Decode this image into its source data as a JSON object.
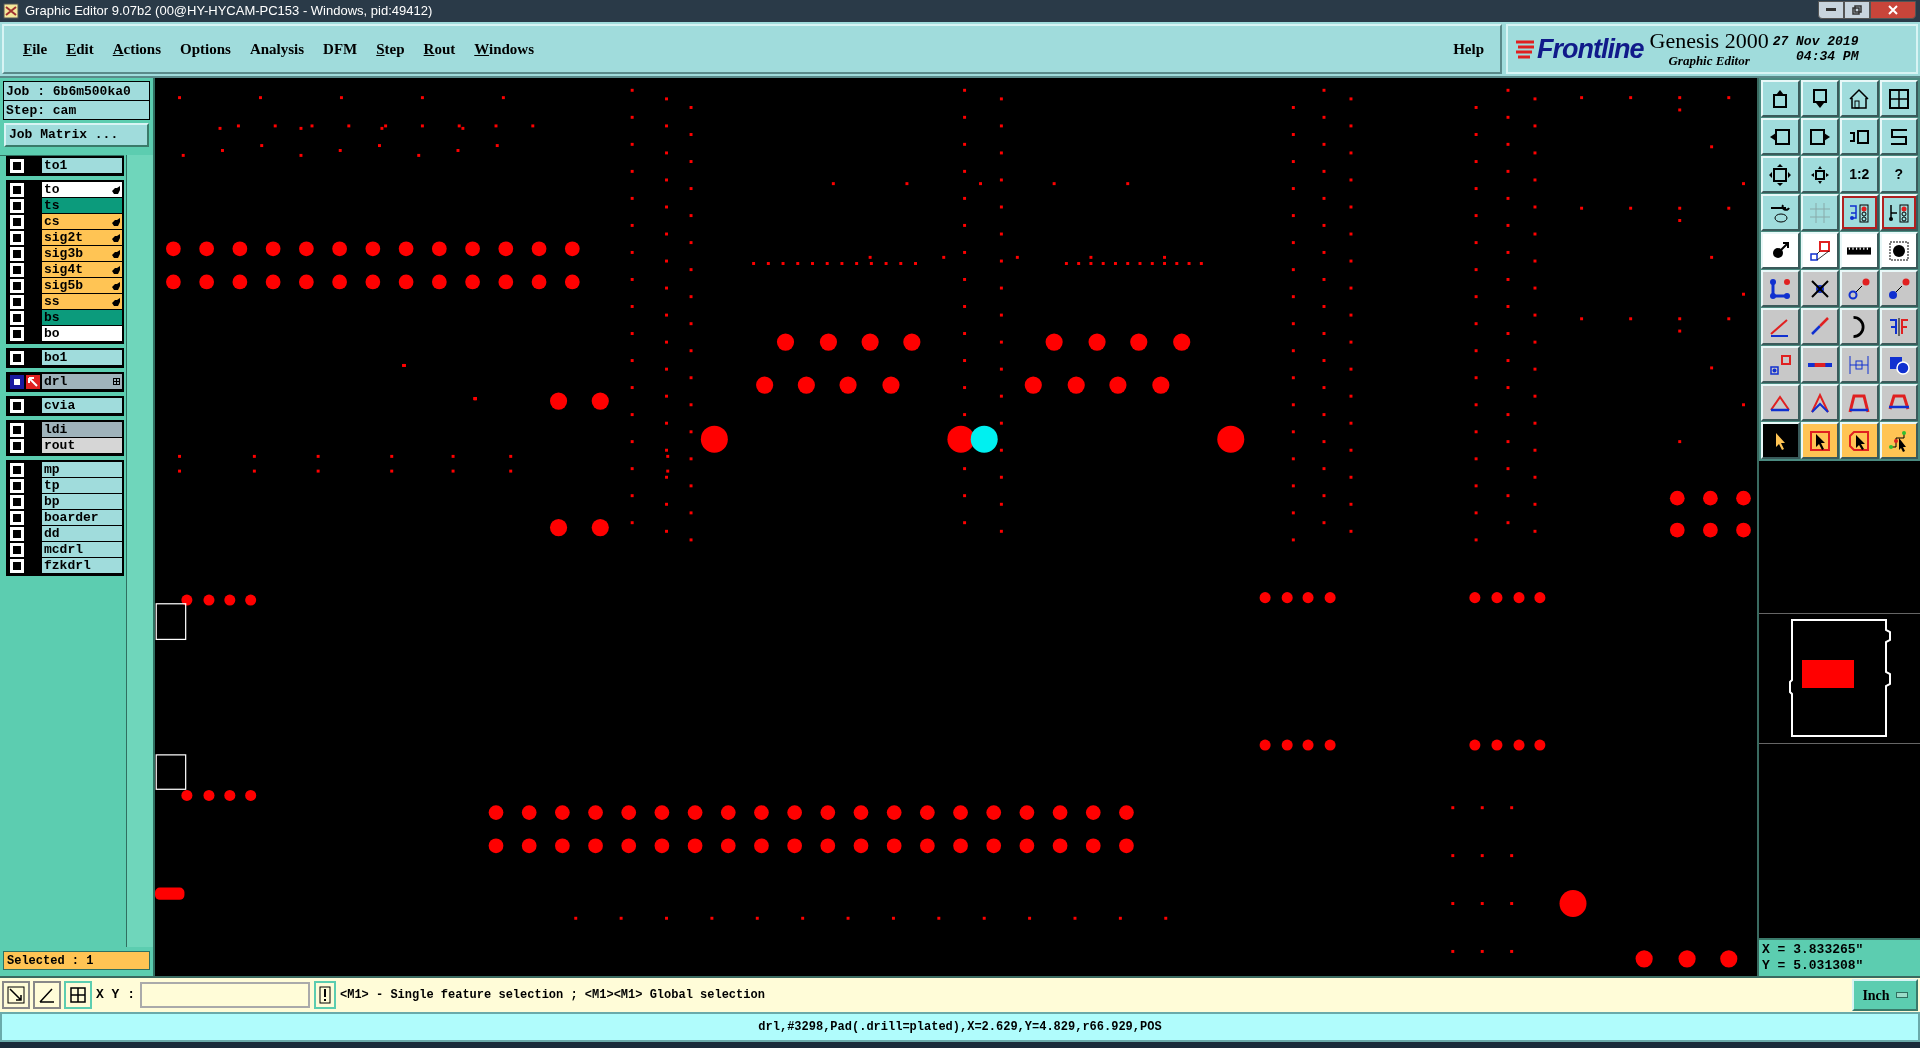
{
  "window": {
    "title": "Graphic Editor 9.07b2 (00@HY-HYCAM-PC153 - Windows, pid:49412)"
  },
  "menu": [
    {
      "label": "File",
      "mnemonic": true
    },
    {
      "label": "Edit",
      "mnemonic": true
    },
    {
      "label": "Actions",
      "mnemonic": true
    },
    {
      "label": "Options",
      "mnemonic": false
    },
    {
      "label": "Analysis",
      "mnemonic": false
    },
    {
      "label": "DFM",
      "mnemonic": false
    },
    {
      "label": "Step",
      "mnemonic": true
    },
    {
      "label": "Rout",
      "mnemonic": true
    },
    {
      "label": "Windows",
      "mnemonic": true
    }
  ],
  "help": "Help",
  "brand": {
    "logo": "Frontline",
    "product": "Genesis 2000",
    "subtitle": "Graphic Editor",
    "date": "27 Nov 2019",
    "time": "04:34 PM"
  },
  "job": "Job : 6b6m500ka0",
  "step": "Step: cam",
  "job_matrix": "Job Matrix ...",
  "layer_groups": [
    [
      {
        "name": "to1",
        "color": "#a0dcdc",
        "affected": false,
        "active": false
      }
    ],
    [
      {
        "name": "to",
        "color": "#ffffff",
        "affected": true,
        "active": false
      },
      {
        "name": "ts",
        "color": "#0c9b7c",
        "affected": false,
        "active": false
      },
      {
        "name": "cs",
        "color": "#ffc454",
        "affected": true,
        "active": false
      },
      {
        "name": "sig2t",
        "color": "#ffc454",
        "affected": true,
        "active": false
      },
      {
        "name": "sig3b",
        "color": "#ffc454",
        "affected": true,
        "active": false
      },
      {
        "name": "sig4t",
        "color": "#ffc454",
        "affected": true,
        "active": false
      },
      {
        "name": "sig5b",
        "color": "#ffc454",
        "affected": true,
        "active": false
      },
      {
        "name": "ss",
        "color": "#ffc454",
        "affected": true,
        "active": false
      },
      {
        "name": "bs",
        "color": "#0c9b7c",
        "affected": false,
        "active": false
      },
      {
        "name": "bo",
        "color": "#ffffff",
        "affected": false,
        "active": false
      }
    ],
    [
      {
        "name": "bo1",
        "color": "#a0dcdc",
        "affected": false,
        "active": false
      }
    ],
    [
      {
        "name": "drl",
        "color": "#9fb3bb",
        "affected": false,
        "active": true
      }
    ],
    [
      {
        "name": "cvia",
        "color": "#a0dcdc",
        "affected": false,
        "active": false
      }
    ],
    [
      {
        "name": "ldi",
        "color": "#9fb3bb",
        "affected": false,
        "active": false
      },
      {
        "name": "rout",
        "color": "#d6d6d6",
        "affected": false,
        "active": false
      }
    ],
    [
      {
        "name": "mp",
        "color": "#a0dcdc",
        "affected": false,
        "active": false
      },
      {
        "name": "tp",
        "color": "#a0dcdc",
        "affected": false,
        "active": false
      },
      {
        "name": "bp",
        "color": "#a0dcdc",
        "affected": false,
        "active": false
      },
      {
        "name": "boarder",
        "color": "#a0dcdc",
        "affected": false,
        "active": false
      },
      {
        "name": "dd",
        "color": "#a0dcdc",
        "affected": false,
        "active": false
      },
      {
        "name": "mcdrl",
        "color": "#a0dcdc",
        "affected": false,
        "active": false
      },
      {
        "name": "fzkdrl",
        "color": "#a0dcdc",
        "affected": false,
        "active": false
      }
    ]
  ],
  "selected_count": "Selected : 1",
  "toolbar": {
    "scale_label": "1:2",
    "help_label": "?",
    "selection_modes": [
      {
        "selected": true
      },
      {
        "selected": false
      },
      {
        "selected": false
      },
      {
        "selected": false
      }
    ]
  },
  "coordinates": {
    "x": "X = 3.833265\"",
    "y": "Y = 5.031308\""
  },
  "command": {
    "xy_label": "X Y :",
    "prompt": "<M1> - Single feature selection ; <M1><M1> Global selection",
    "units": "Inch"
  },
  "status_bar": "drl,#3298,Pad(.drill=plated),X=2.629,Y=4.829,r66.929,POS"
}
